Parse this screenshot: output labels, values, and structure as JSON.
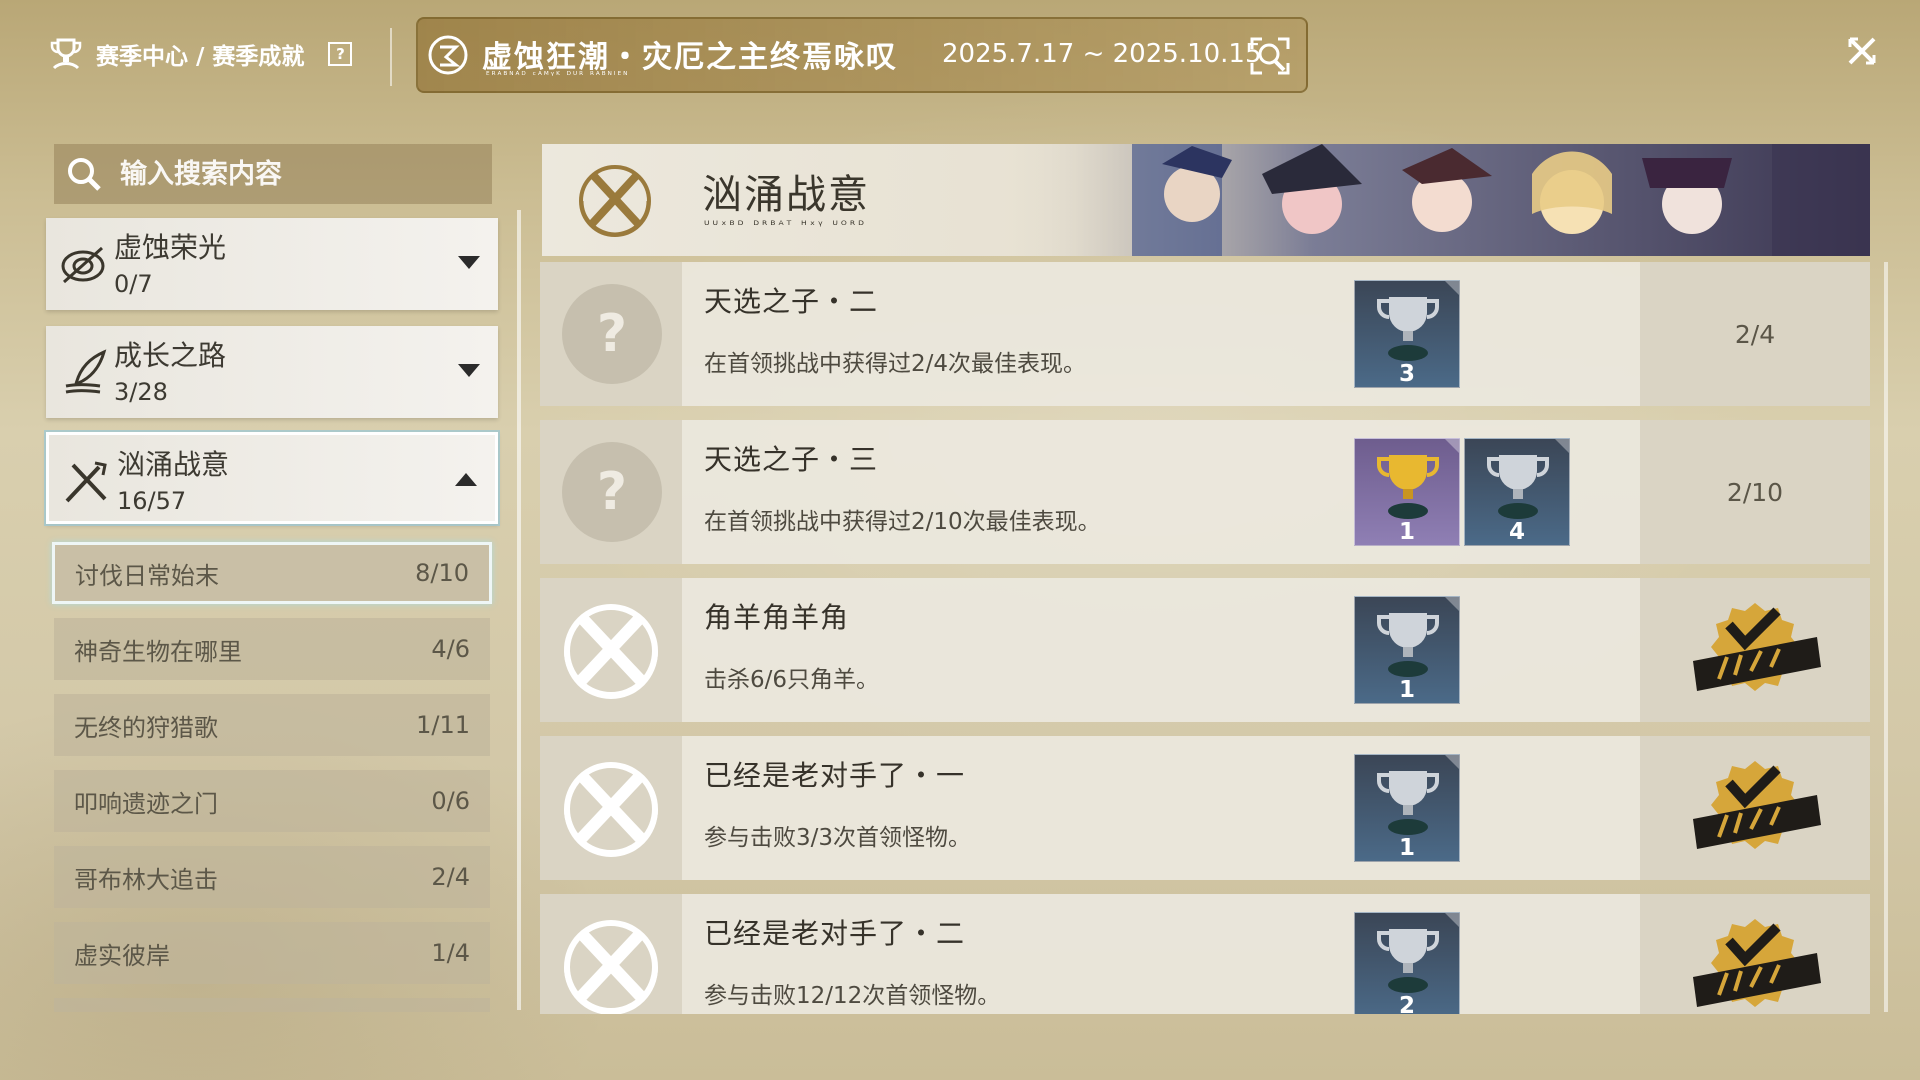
{
  "header": {
    "breadcrumb": "赛季中心 / 赛季成就",
    "help_glyph": "?",
    "season_title": "虚蚀狂潮・灾厄之主终焉咏叹",
    "season_subtitle": "ᴱᴿᴬᴮᴺᴬᴰ ᶜᴬᴹᵞᴷ ᴰᵁᴿ ᴿᴬᴮᴺᴵᴱᴺ",
    "season_dates": "2025.7.17 ~ 2025.10.15"
  },
  "search": {
    "placeholder": "输入搜索内容"
  },
  "categories": [
    {
      "name": "虚蚀荣光",
      "count": "0/7",
      "expanded": false
    },
    {
      "name": "成长之路",
      "count": "3/28",
      "expanded": false
    },
    {
      "name": "汹涌战意",
      "count": "16/57",
      "expanded": true
    }
  ],
  "subcategories": [
    {
      "name": "讨伐日常始末",
      "count": "8/10",
      "selected": true
    },
    {
      "name": "神奇生物在哪里",
      "count": "4/6"
    },
    {
      "name": "无终的狩猎歌",
      "count": "1/11"
    },
    {
      "name": "叩响遗迹之门",
      "count": "0/6"
    },
    {
      "name": "哥布林大追击",
      "count": "2/4"
    },
    {
      "name": "虚实彼岸",
      "count": "1/4"
    }
  ],
  "banner": {
    "title": "汹涌战意",
    "subtitle": "ᵁᵁˣᴮᴰ ᴰᴿᴮᴬᵀ ᴴˣᵞ ᵁᴼᴿᴰ"
  },
  "achievements": [
    {
      "title": "天选之子・二",
      "desc": "在首领挑战中获得过2/4次最佳表现。",
      "progress": "2/4",
      "completed": false,
      "trophies": [
        {
          "tier": "silver",
          "count": "3"
        }
      ]
    },
    {
      "title": "天选之子・三",
      "desc": "在首领挑战中获得过2/10次最佳表现。",
      "progress": "2/10",
      "completed": false,
      "trophies": [
        {
          "tier": "gold",
          "count": "1"
        },
        {
          "tier": "silver",
          "count": "4"
        }
      ]
    },
    {
      "title": "角羊角羊角",
      "desc": "击杀6/6只角羊。",
      "progress": "",
      "completed": true,
      "trophies": [
        {
          "tier": "silver",
          "count": "1"
        }
      ]
    },
    {
      "title": "已经是老对手了・一",
      "desc": "参与击败3/3次首领怪物。",
      "progress": "",
      "completed": true,
      "trophies": [
        {
          "tier": "silver",
          "count": "1"
        }
      ]
    },
    {
      "title": "已经是老对手了・二",
      "desc": "参与击败12/12次首领怪物。",
      "progress": "",
      "completed": true,
      "trophies": [
        {
          "tier": "silver",
          "count": "2"
        }
      ]
    }
  ],
  "colors": {
    "accent_gold": "#c9a14a",
    "panel": "#ece8de",
    "selected_glow": "#aadde0"
  },
  "icons": [
    "season-achievement-icon",
    "help-icon",
    "season-emblem-icon",
    "season-preview-icon",
    "close-icon",
    "search-icon",
    "trophy-icon",
    "completed-stamp-icon",
    "locked-question-icon"
  ]
}
